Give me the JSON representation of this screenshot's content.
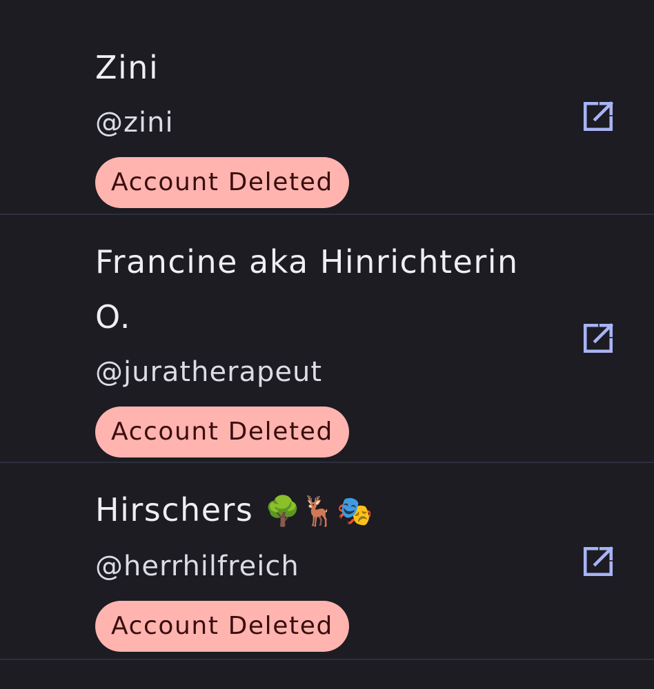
{
  "accounts": [
    {
      "display_name": "Zini",
      "handle": "@zini",
      "status": "Account Deleted"
    },
    {
      "display_name": "Francine aka Hinrichterin O.",
      "handle": "@juratherapeut",
      "status": "Account Deleted"
    },
    {
      "display_name": "Hirschers",
      "emoji": "🌳🦌🎭",
      "handle": "@herrhilfreich",
      "status": "Account Deleted"
    }
  ],
  "colors": {
    "background": "#1c1c22",
    "divider": "#2e2f3c",
    "badge_bg": "#ffb4b0",
    "badge_text": "#3a0d0d",
    "icon": "#a9b4f5"
  },
  "icons": {
    "open_external": "open-external-icon"
  }
}
